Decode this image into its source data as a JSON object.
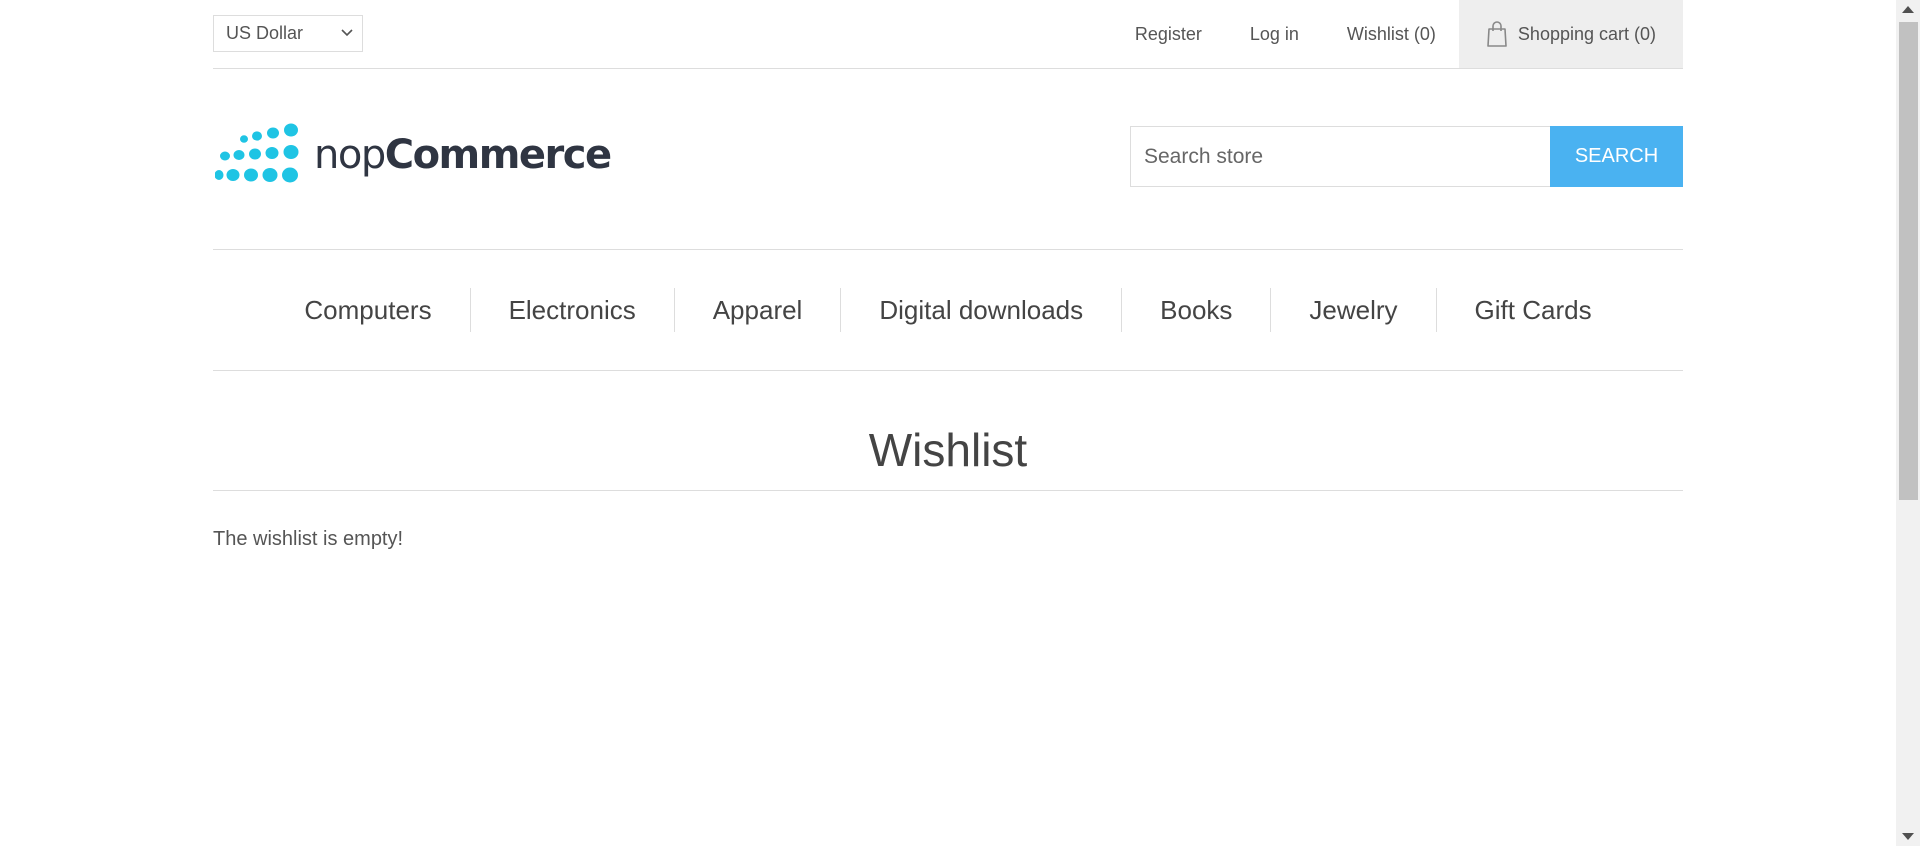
{
  "header": {
    "currency": "US Dollar",
    "links": {
      "register": "Register",
      "login": "Log in",
      "wishlist": "Wishlist (0)",
      "cart": "Shopping cart (0)"
    }
  },
  "logo": {
    "prefix": "nop",
    "suffix": "Commerce"
  },
  "search": {
    "placeholder": "Search store",
    "button": "Search"
  },
  "nav": [
    "Computers",
    "Electronics",
    "Apparel",
    "Digital downloads",
    "Books",
    "Jewelry",
    "Gift Cards"
  ],
  "page": {
    "title": "Wishlist",
    "empty_message": "The wishlist is empty!"
  },
  "colors": {
    "accent": "#4ab2f1",
    "logo_dots": "#1fc4e4",
    "logo_text": "#2f3542"
  },
  "icons": [
    "chevron-down-icon",
    "shopping-bag-icon",
    "logo-dots-icon"
  ]
}
